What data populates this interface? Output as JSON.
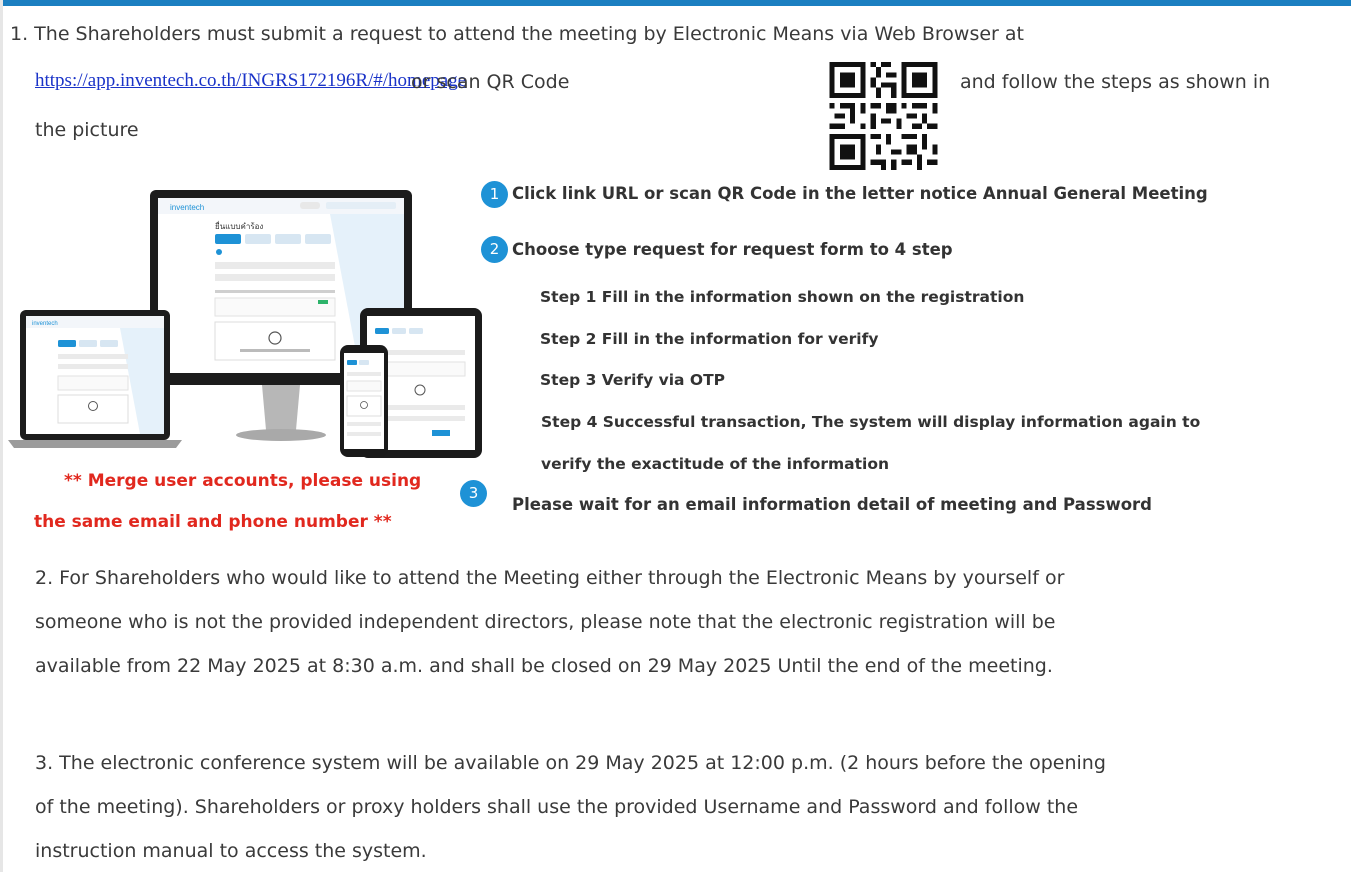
{
  "item1": {
    "text": "1.  The Shareholders must submit a request to attend the meeting by Electronic Means via Web Browser at",
    "link": "https://app.inventech.co.th/INGRS172196R/#/homepage",
    "or_scan": "or scan QR Code",
    "follow": "and follow the steps as shown in",
    "picture": "the picture"
  },
  "steps": [
    {
      "num": "1",
      "text": "Click link URL or scan QR Code in the letter notice Annual General Meeting"
    },
    {
      "num": "2",
      "text": "Choose type request for request form to 4 step"
    },
    {
      "num": "3",
      "text": "Please wait for an email information detail of meeting and Password"
    }
  ],
  "substeps": [
    "Step 1 Fill in the information shown on the registration",
    "Step 2 Fill in the information for verify",
    "Step 3 Verify via OTP",
    "Step 4 Successful transaction, The system will display information again to",
    "verify the exactitude of the information"
  ],
  "note": {
    "line1": "** Merge user accounts, please using",
    "line2": "the same email and phone number **"
  },
  "para2": [
    "2. For Shareholders who would like to attend the Meeting either through the Electronic Means by yourself or",
    "someone who is not the provided independent directors, please note that the electronic registration will be",
    "available from 22 May 2025 at 8:30 a.m. and shall be closed on 29 May 2025 Until the end of the meeting."
  ],
  "para3": [
    "3. The electronic conference system will be available on 29 May 2025 at 12:00 p.m. (2 hours before the opening",
    "of the meeting). Shareholders or proxy holders shall use the provided Username and Password and follow the",
    "instruction manual to access the system."
  ],
  "mockup": {
    "brand": "inventech",
    "form_title": "ยื่นแบบคำร้อง"
  },
  "colors": {
    "accent": "#1e92d6",
    "warning": "#e1281e",
    "link": "#1a33c8"
  }
}
